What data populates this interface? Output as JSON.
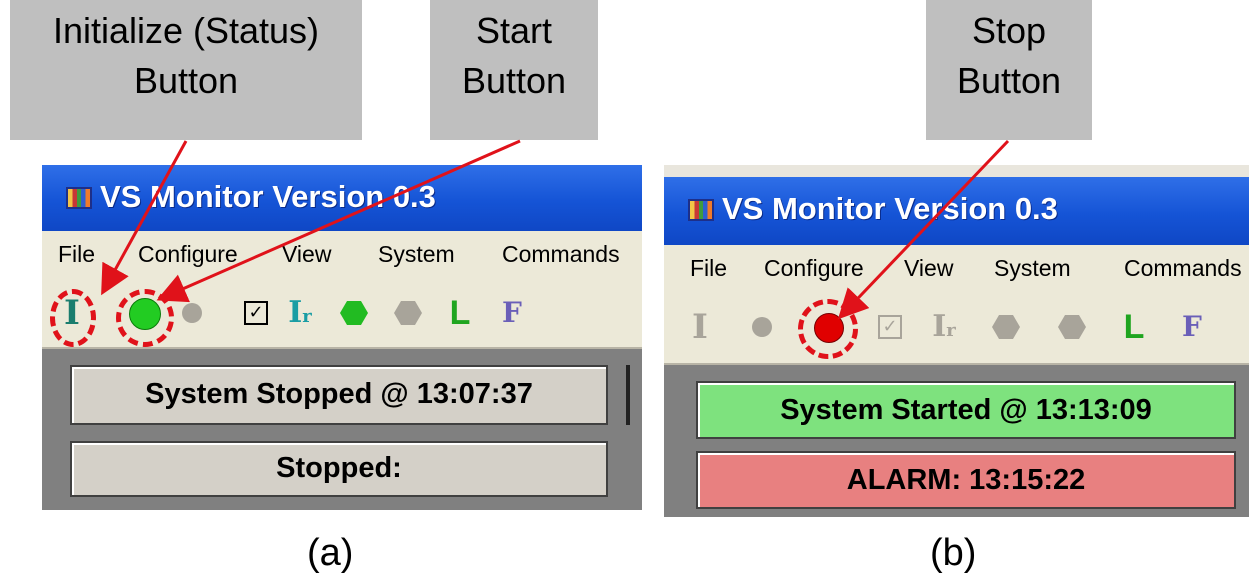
{
  "callouts": {
    "initialize": [
      "Initialize (Status)",
      "Button"
    ],
    "start": [
      "Start",
      "Button"
    ],
    "stop": [
      "Stop",
      "Button"
    ]
  },
  "captions": {
    "a": "(a)",
    "b": "(b)"
  },
  "window_a": {
    "title": "VS Monitor Version 0.3",
    "menu": [
      "File",
      "Configure",
      "View",
      "System",
      "Commands"
    ],
    "toolbar_icons": [
      "initialize-icon",
      "start-icon",
      "stop-icon",
      "check-icon",
      "initialize-tr-icon",
      "run-step-icon",
      "hold-icon",
      "log-icon",
      "file-icon"
    ],
    "status_line": "System Stopped @ 13:07:37",
    "state_line": "Stopped:",
    "status_color": "#d4d0c8",
    "state_color": "#d4d0c8"
  },
  "window_b": {
    "title": "VS Monitor Version 0.3",
    "menu": [
      "File",
      "Configure",
      "View",
      "System",
      "Commands"
    ],
    "toolbar_icons": [
      "initialize-icon",
      "start-icon",
      "stop-icon",
      "check-icon",
      "initialize-tr-icon",
      "run-step-icon",
      "hold-icon",
      "log-icon",
      "file-icon"
    ],
    "status_line": "System Started @ 13:13:09",
    "state_line": "ALARM: 13:15:22",
    "status_color": "#7ee27e",
    "state_color": "#e88080"
  },
  "colors": {
    "highlight_ring": "#e0121a",
    "arrow": "#e0121a",
    "start_green": "#22cc22",
    "stop_red": "#e00000",
    "disabled_gray": "#a8a49a"
  }
}
